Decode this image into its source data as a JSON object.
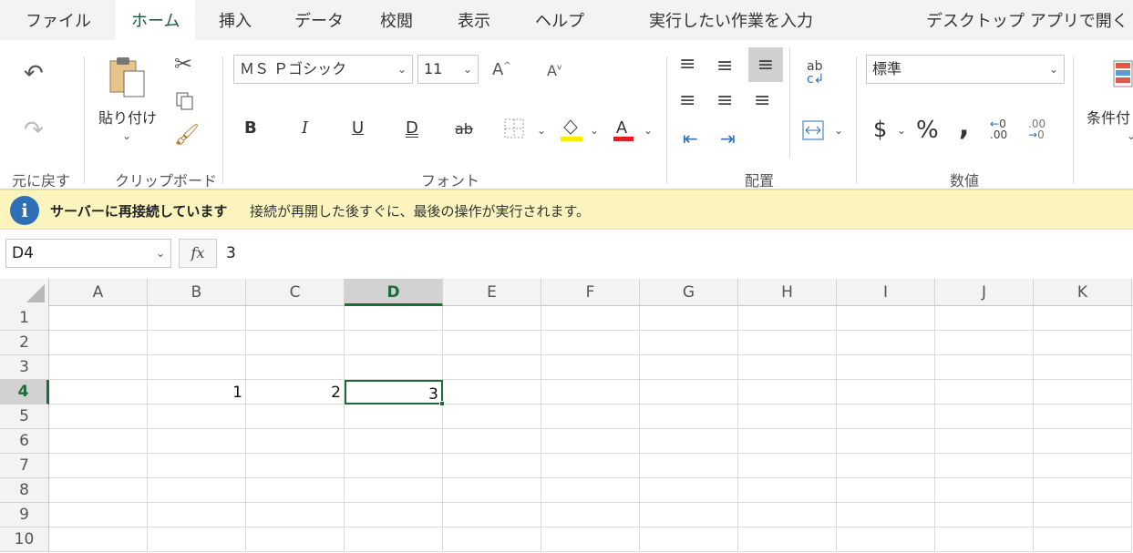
{
  "tabs": {
    "file": "ファイル",
    "home": "ホーム",
    "insert": "挿入",
    "data": "データ",
    "review": "校閲",
    "view": "表示",
    "help": "ヘルプ",
    "tell_me": "実行したい作業を入力",
    "open_desktop": "デスクトップ アプリで開く"
  },
  "ribbon": {
    "undo_label": "元に戻す",
    "paste_label": "貼り付け",
    "clipboard_label": "クリップボード",
    "font_name": "ＭＳ Ｐゴシック",
    "font_size": "11",
    "bold": "B",
    "italic": "I",
    "underline": "U",
    "double_underline": "D",
    "strikethrough": "ab",
    "font_label": "フォント",
    "alignment_label": "配置",
    "number_format": "標準",
    "currency": "$",
    "percent": "%",
    "comma": ",",
    "number_label": "数値",
    "conditional_format": "条件付",
    "colors": {
      "fill_color": "#ffeb00",
      "font_color": "#e02020",
      "accent": "#1e6b3a"
    }
  },
  "infobar": {
    "title": "サーバーに再接続しています",
    "message": "接続が再開した後すぐに、最後の操作が実行されます。"
  },
  "formula_bar": {
    "name_box": "D4",
    "fx": "fx",
    "value": "3"
  },
  "sheet": {
    "columns": [
      "A",
      "B",
      "C",
      "D",
      "E",
      "F",
      "G",
      "H",
      "I",
      "J",
      "K"
    ],
    "rows": [
      "1",
      "2",
      "3",
      "4",
      "5",
      "6",
      "7",
      "8",
      "9",
      "10"
    ],
    "selected_column": "D",
    "selected_row": "4",
    "cells": [
      {
        "ref": "B4",
        "col": 1,
        "row": 3,
        "value": "1"
      },
      {
        "ref": "C4",
        "col": 2,
        "row": 3,
        "value": "2"
      },
      {
        "ref": "D4",
        "col": 3,
        "row": 3,
        "value": "3"
      }
    ]
  }
}
